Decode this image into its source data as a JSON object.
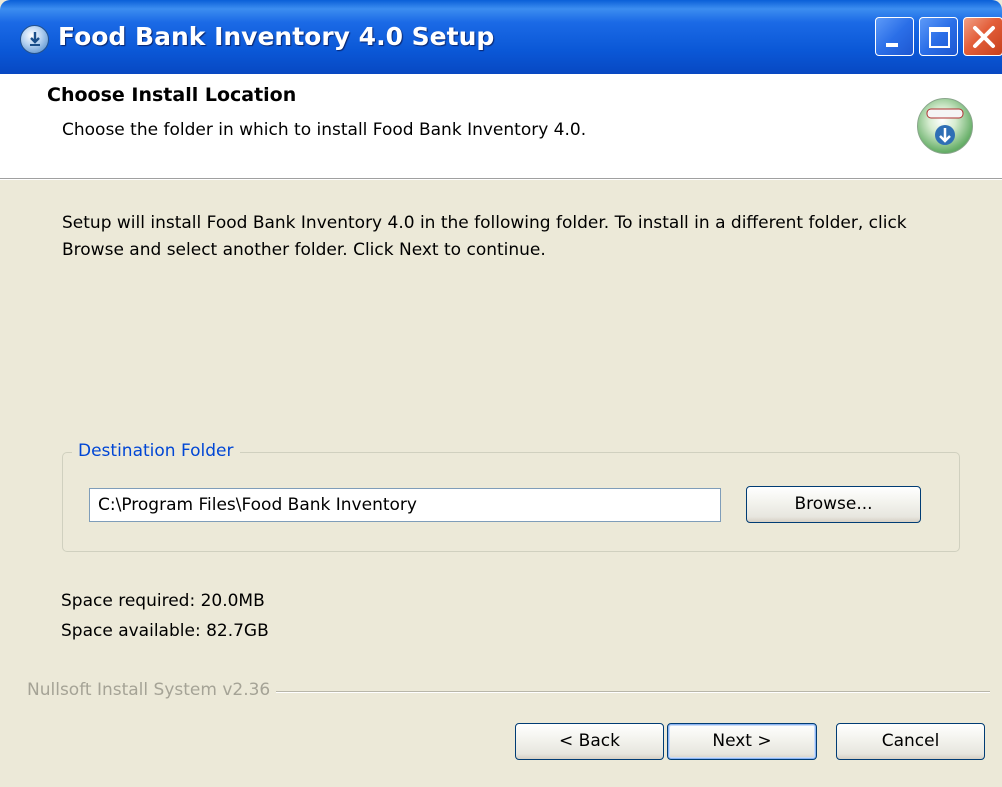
{
  "window": {
    "title": "Food Bank Inventory 4.0 Setup",
    "icon": "installer-icon"
  },
  "caption_buttons": {
    "minimize": "minimize-icon",
    "maximize": "maximize-icon",
    "close": "close-icon"
  },
  "header": {
    "title": "Choose Install Location",
    "subtitle": "Choose the folder in which to install Food Bank Inventory 4.0.",
    "icon": "nsis-install-icon"
  },
  "body": {
    "instructions": "Setup will install Food Bank Inventory 4.0 in the following folder. To install in a different folder, click Browse and select another folder. Click Next to continue."
  },
  "destination": {
    "legend": "Destination Folder",
    "path": "C:\\Program Files\\Food Bank Inventory",
    "browse_label": "Browse..."
  },
  "space": {
    "required": "Space required: 20.0MB",
    "available": "Space available: 82.7GB"
  },
  "branding": "Nullsoft Install System v2.36",
  "buttons": {
    "back": "< Back",
    "next": "Next >",
    "cancel": "Cancel"
  },
  "colors": {
    "titlebar": "#0a57d6",
    "dialog_bg": "#ece9d8",
    "legend_text": "#0046d5",
    "close_button": "#e35f3a"
  }
}
